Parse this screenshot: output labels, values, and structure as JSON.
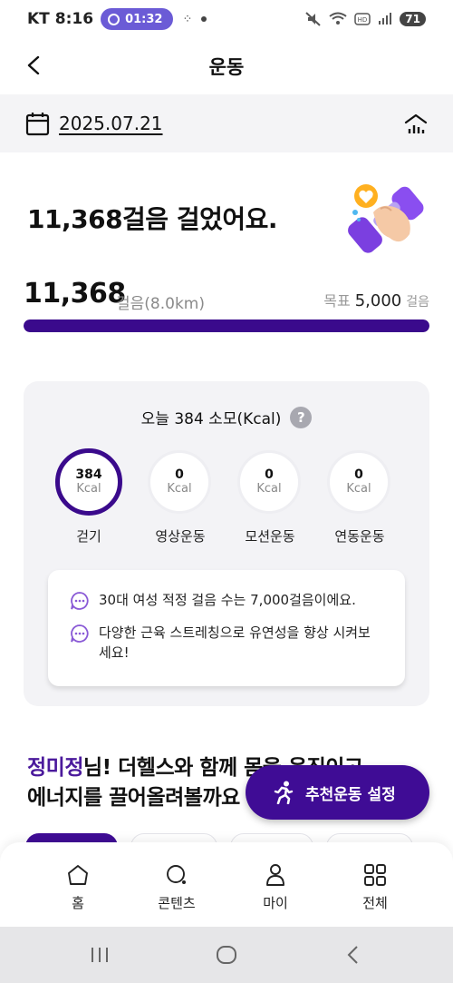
{
  "status_bar": {
    "carrier": "KT",
    "time": "8:16",
    "timer": "01:32",
    "battery": "71"
  },
  "header": {
    "title": "운동"
  },
  "date": {
    "value": "2025.07.21"
  },
  "summary": {
    "headline": "11,368걸음 걸었어요.",
    "steps": "11,368",
    "steps_sub": "걸음(8.0km)",
    "goal_label": "목표",
    "goal_value": "5,000",
    "goal_unit": "걸음",
    "progress_fraction": 1.0
  },
  "calories": {
    "title": "오늘 384 소모(Kcal)",
    "help": "?",
    "items": [
      {
        "value": "384",
        "unit": "Kcal",
        "label": "걷기",
        "active": true
      },
      {
        "value": "0",
        "unit": "Kcal",
        "label": "영상운동",
        "active": false
      },
      {
        "value": "0",
        "unit": "Kcal",
        "label": "모션운동",
        "active": false
      },
      {
        "value": "0",
        "unit": "Kcal",
        "label": "연동운동",
        "active": false
      }
    ]
  },
  "tips": [
    "30대 여성 적정 걸음 수는 7,000걸음이에요.",
    "다양한 근육 스트레칭으로 유연성을 향상 시켜보세요!"
  ],
  "promo": {
    "name": "정미정",
    "line1_rest": "님! 더헬스와 함께 몸을 움직이고",
    "line2": "에너지를 끌어올려볼까요"
  },
  "fab": {
    "label": "추천운동 설정"
  },
  "bottom_nav": [
    {
      "label": "홈",
      "icon": "home-icon"
    },
    {
      "label": "콘텐츠",
      "icon": "search-icon"
    },
    {
      "label": "마이",
      "icon": "person-icon"
    },
    {
      "label": "전체",
      "icon": "grid-icon"
    }
  ],
  "colors": {
    "accent": "#3a0a8c",
    "fab": "#3f0c95",
    "card_bg": "#f3f3f6"
  }
}
